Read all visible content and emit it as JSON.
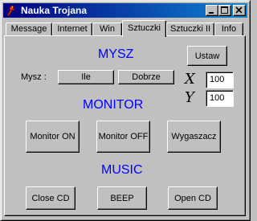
{
  "window": {
    "title": "Nauka Trojana"
  },
  "tabs": [
    {
      "label": "Message"
    },
    {
      "label": "Internet"
    },
    {
      "label": "Win"
    },
    {
      "label": "Sztuczki"
    },
    {
      "label": "Sztuczki II"
    },
    {
      "label": "Info"
    }
  ],
  "active_tab": "Sztuczki",
  "mysz": {
    "heading": "MYSZ",
    "label": "Mysz :",
    "ile_button": "Ile",
    "dobrze_button": "Dobrze",
    "ustaw_button": "Ustaw",
    "x_label": "X",
    "y_label": "Y",
    "x_value": "100",
    "y_value": "100"
  },
  "monitor": {
    "heading": "MONITOR",
    "on_button": "Monitor ON",
    "off_button": "Monitor OFF",
    "screensaver_button": "Wygaszacz"
  },
  "music": {
    "heading": "MUSIC",
    "close_cd_button": "Close CD",
    "beep_button": "BEEP",
    "open_cd_button": "Open CD"
  },
  "colors": {
    "titlebar": "#000080",
    "heading": "#0000ff",
    "face": "#c0c0c0"
  }
}
